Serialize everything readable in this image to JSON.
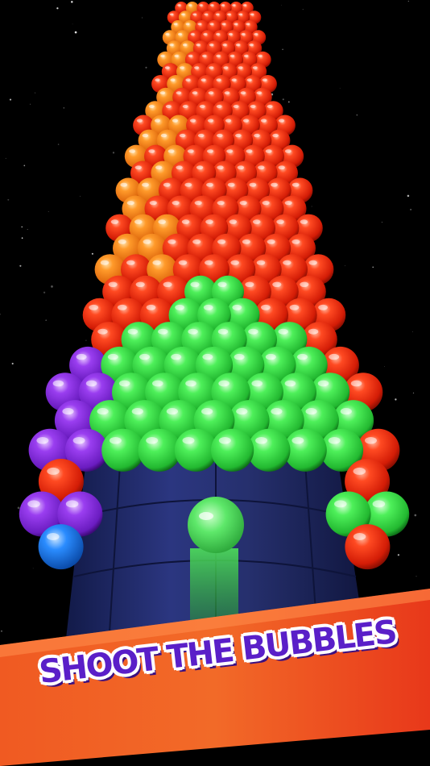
{
  "banner": {
    "text": "SHOOT THE BUBBLES"
  },
  "colors": {
    "background": "#000000",
    "tower": "#26306e",
    "bubble_red": "#e8290f",
    "bubble_orange": "#f58a1e",
    "bubble_green": "#38e04a",
    "bubble_purple": "#8a2ee0",
    "bubble_blue": "#1e7ff0",
    "banner": "#f04c1a",
    "banner_text": "#5a1fc8"
  },
  "player": {
    "bubble_color": "green"
  }
}
